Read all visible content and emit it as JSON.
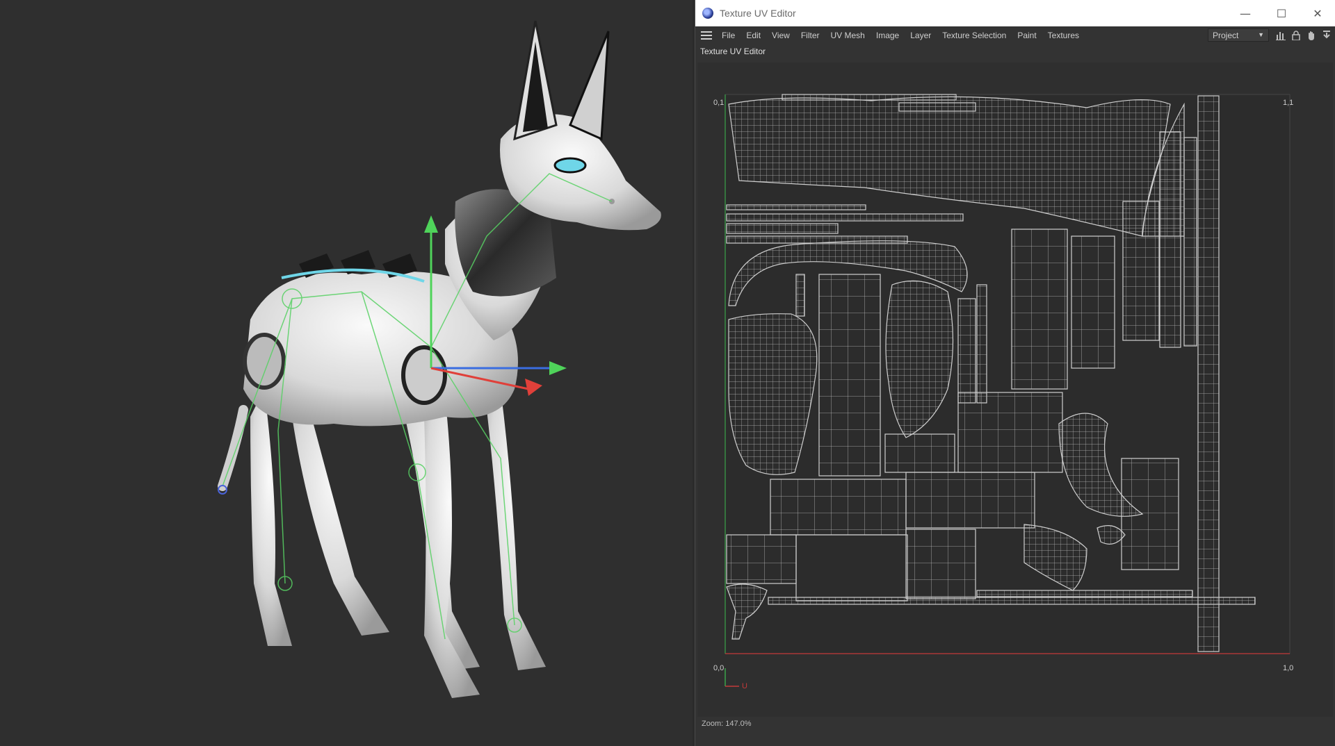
{
  "window": {
    "title": "Texture UV Editor",
    "minimize_glyph": "—",
    "maximize_glyph": "☐",
    "close_glyph": "✕"
  },
  "menu": {
    "items": [
      "File",
      "Edit",
      "View",
      "Filter",
      "UV Mesh",
      "Image",
      "Layer",
      "Texture Selection",
      "Paint",
      "Textures"
    ],
    "project_select": "Project"
  },
  "toolbar": {
    "icons": [
      "histogram-icon",
      "lock-icon",
      "hand-icon",
      "pin-icon"
    ]
  },
  "panel": {
    "label": "Texture UV Editor"
  },
  "uv_view": {
    "corner_top_left": "0,1",
    "corner_top_right": "1,1",
    "corner_bottom_left": "0,0",
    "corner_bottom_right": "1,0",
    "axis_u_label": "U",
    "grid_color": "#bdbdbd",
    "u_axis_color": "#c43a3a",
    "v_axis_color": "#3aa34a"
  },
  "status": {
    "zoom": "Zoom: 147.0%"
  },
  "colors": {
    "viewport_bg": "#2f2f2f",
    "model_body": "#e6e6e6",
    "rig_green": "#57d163",
    "accent_cyan": "#6fd6e8"
  }
}
